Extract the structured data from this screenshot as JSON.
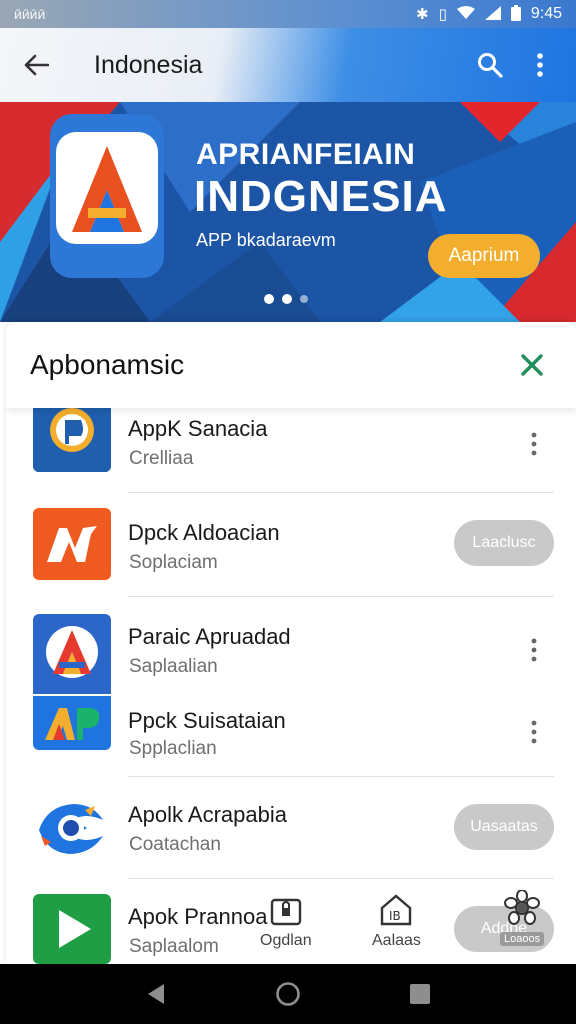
{
  "status_bar": {
    "left": "ӣӣӣӣ",
    "time": "9:45",
    "icons": [
      "bluetooth-icon",
      "vibrate-icon",
      "wifi-icon",
      "signal-icon",
      "battery-icon"
    ]
  },
  "app_bar": {
    "title": "Indonesia",
    "icons": [
      "back-arrow-icon",
      "search-icon",
      "more-vert-icon"
    ]
  },
  "banner": {
    "title_line1": "APRIANFEIAIN",
    "title_line2": "INDGNESIA",
    "subtitle": "APP bkadaraevm",
    "cta_label": "Aaprium",
    "page_indicator": {
      "count": 3,
      "active": 0
    }
  },
  "sheet": {
    "title": "Apbonamsic",
    "close_icon": "close-x-icon",
    "accent": "#1e8e5a",
    "apps": [
      {
        "name": "AppK Sanacia",
        "category": "Crelliaa",
        "action": "more"
      },
      {
        "name": "Dpck Aldoacian",
        "category": "Soplaciam",
        "action": "pill",
        "action_label": "Laaclusc"
      },
      {
        "name": "Paraic Apruadad",
        "category": "Saplaalian",
        "action": "more"
      },
      {
        "name": "Ppck Suisataian",
        "category": "Spplaclian",
        "action": "more"
      },
      {
        "name": "Apolk Acrapabia",
        "category": "Coatachan",
        "action": "pill",
        "action_label": "Uasaatas"
      },
      {
        "name": "Apok Prannoa",
        "category": "Saplaalom",
        "action": "pill",
        "action_label": "Addhe"
      }
    ],
    "bottom_tabs": [
      {
        "label": "Ogdlan",
        "icon": "lock-bag-icon"
      },
      {
        "label": "Aalaas",
        "icon": "home-ib-icon"
      },
      {
        "label": "Loaoos",
        "icon": "gear-flower-icon"
      }
    ]
  },
  "nav_bar": {
    "icons": [
      "back-triangle-icon",
      "home-circle-icon",
      "recents-square-icon"
    ]
  },
  "colors": {
    "brand_blue": "#1f74e0",
    "cta_orange": "#f4ae2e",
    "pill_gray": "#c9c9c9"
  }
}
